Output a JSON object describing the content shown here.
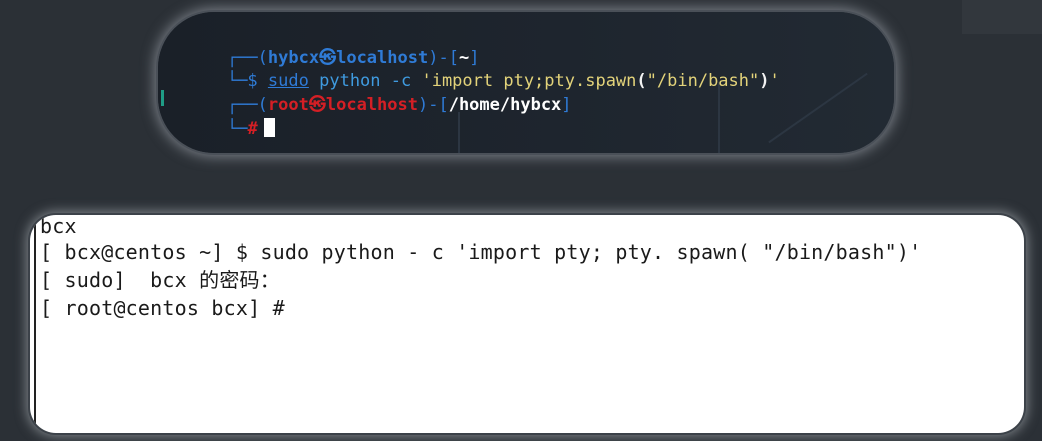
{
  "kali_terminal": {
    "line1": {
      "open": "┌──(",
      "user": "hybcx",
      "at": "㉿",
      "host": "localhost",
      "close": ")-[",
      "cwd": "~",
      "end": "]"
    },
    "line2": {
      "prompt": "└─$ ",
      "cmd": "sudo",
      "space": " ",
      "word1": "python -c ",
      "str1": "'import pty;pty.spawn",
      "paren_open": "(",
      "str2": "\"/bin/bash\"",
      "paren_close": ")",
      "str3": "'"
    },
    "line3": {
      "open": "┌──(",
      "user": "root",
      "at": "㉿",
      "host": "localhost",
      "close": ")-[",
      "cwd": "/home/hybcx",
      "end": "]"
    },
    "line4": {
      "prompt": "└─",
      "hash": "#"
    }
  },
  "centos_terminal": {
    "lines": [
      "bcx",
      "[ bcx@centos ~] $ sudo python - c 'import pty; pty. spawn( \"/bin/bash\")'",
      "[ sudo]  bcx 的密码：",
      "[ root@centos bcx] #"
    ]
  },
  "colors": {
    "kali_blue": "#2f7bd6",
    "kali_red": "#d41f25",
    "kali_yellow": "#e3d37a",
    "page_bg": "#2b3036"
  }
}
